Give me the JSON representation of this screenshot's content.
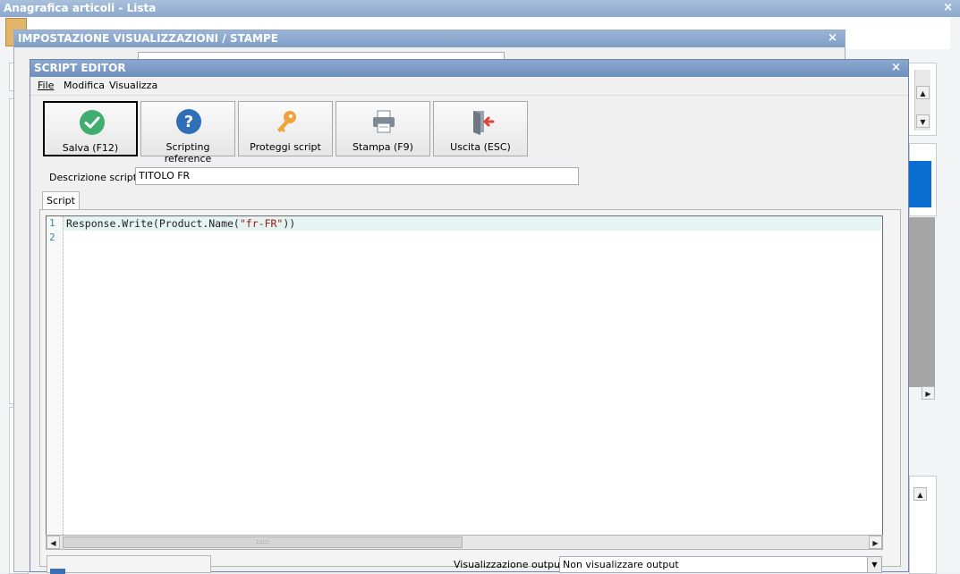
{
  "background_window": {
    "title": "Anagrafica articoli  - Lista",
    "close_glyph": "×"
  },
  "middle_window": {
    "title": "IMPOSTAZIONE VISUALIZZAZIONI / STAMPE",
    "close_glyph": "×"
  },
  "editor": {
    "title": "SCRIPT EDITOR",
    "close_glyph": "×",
    "menu": {
      "file": "File",
      "modifica": "Modifica",
      "visualizza": "Visualizza"
    },
    "toolbar": {
      "save": {
        "label": "Salva (F12)",
        "icon": "check-icon"
      },
      "reference": {
        "label": "Scripting reference",
        "icon": "help-icon"
      },
      "protect": {
        "label": "Proteggi script",
        "icon": "key-icon"
      },
      "print": {
        "label": "Stampa (F9)",
        "icon": "printer-icon"
      },
      "exit": {
        "label": "Uscita (ESC)",
        "icon": "exit-door-icon"
      }
    },
    "description_label": "Descrizione script :",
    "description_value": "TITOLO FR",
    "tab_script": "Script",
    "code": {
      "line_numbers": [
        "1",
        "2"
      ],
      "line1_before": "Response.Write(Product.Name(",
      "line1_string": "\"fr-FR\"",
      "line1_after": "))",
      "line2": ""
    },
    "output_label": "Visualizzazione output :",
    "output_value": "Non visualizzare output"
  },
  "colors": {
    "title_bar": "#7f9dc4",
    "save_green": "#3fae6e",
    "help_blue": "#2f6fb8",
    "key_orange": "#f0a33a",
    "exit_red": "#d9453a",
    "line_number": "#2b8fa8",
    "string_literal": "#a31515"
  }
}
